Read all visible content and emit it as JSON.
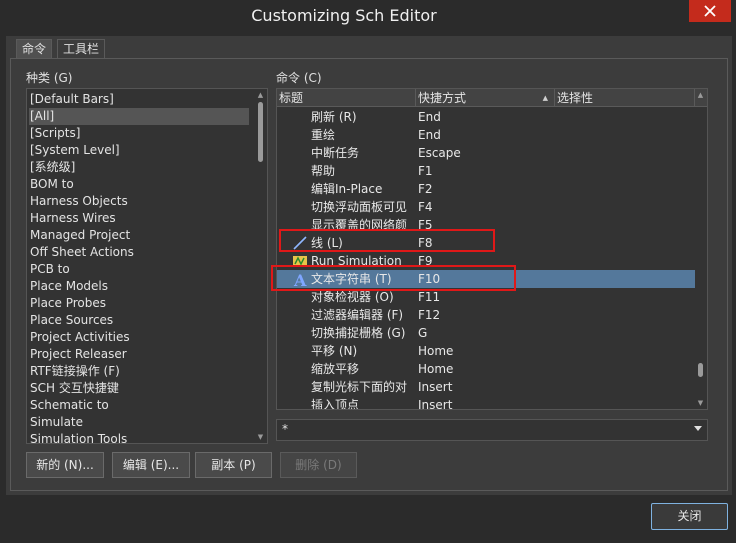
{
  "window": {
    "title": "Customizing Sch Editor"
  },
  "tabs": [
    {
      "label": "命令",
      "active": true
    },
    {
      "label": "工具栏",
      "active": false
    }
  ],
  "categories": {
    "label": "种类 (G)",
    "selected": "[All]",
    "items": [
      "[Default Bars]",
      "[All]",
      "[Scripts]",
      "[System Level]",
      "[系统级]",
      "BOM to",
      "Harness Objects",
      "Harness Wires",
      "Managed Project",
      "Off Sheet Actions",
      "PCB to",
      "Place Models",
      "Place Probes",
      "Place Sources",
      "Project Activities",
      "Project Releaser",
      "RTF链接操作 (F)",
      "SCH 交互快捷键",
      "Schematic to",
      "Simulate",
      "Simulation Tools"
    ]
  },
  "commands": {
    "label": "命令 (C)",
    "columns": {
      "title": "标题",
      "shortcut": "快捷方式",
      "selectivity": "选择性"
    },
    "selected_index": 9,
    "rows": [
      {
        "name": "刷新 (R)",
        "key": "End",
        "icon": ""
      },
      {
        "name": "重绘",
        "key": "End",
        "icon": ""
      },
      {
        "name": "中断任务",
        "key": "Escape",
        "icon": ""
      },
      {
        "name": "帮助",
        "key": "F1",
        "icon": ""
      },
      {
        "name": "编辑In-Place",
        "key": "F2",
        "icon": ""
      },
      {
        "name": "切换浮动面板可见",
        "key": "F4",
        "icon": ""
      },
      {
        "name": "显示覆盖的网络颜",
        "key": "F5",
        "icon": ""
      },
      {
        "name": "线 (L)",
        "key": "F8",
        "icon": "wire-icon"
      },
      {
        "name": "Run Simulation",
        "key": "F9",
        "icon": "run-simulation-icon"
      },
      {
        "name": "文本字符串 (T)",
        "key": "F10",
        "icon": "text-string-icon"
      },
      {
        "name": "对象检视器 (O)",
        "key": "F11",
        "icon": ""
      },
      {
        "name": "过滤器编辑器 (F)",
        "key": "F12",
        "icon": ""
      },
      {
        "name": "切换捕捉栅格 (G)",
        "key": "G",
        "icon": ""
      },
      {
        "name": "平移 (N)",
        "key": "Home",
        "icon": ""
      },
      {
        "name": "缩放平移",
        "key": "Home",
        "icon": ""
      },
      {
        "name": "复制光标下面的对",
        "key": "Insert",
        "icon": ""
      },
      {
        "name": "插入顶点",
        "key": "Insert",
        "icon": ""
      }
    ]
  },
  "filter": {
    "value": "*"
  },
  "buttons": {
    "new": "新的 (N)...",
    "edit": "编辑 (E)...",
    "copy": "副本 (P)",
    "delete": "删除 (D)",
    "close": "关闭"
  },
  "colors": {
    "selection": "#54789b",
    "highlight": "#e01818",
    "close": "#c42b1c"
  }
}
